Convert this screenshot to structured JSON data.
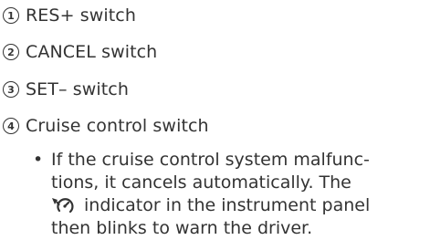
{
  "items": [
    {
      "number": "1",
      "label": "RES+ switch"
    },
    {
      "number": "2",
      "label": "CANCEL switch"
    },
    {
      "number": "3",
      "label": "SET– switch"
    },
    {
      "number": "4",
      "label": "Cruise control switch"
    }
  ],
  "note": {
    "bullet": "•",
    "line1": "If the cruise control system malfunc-",
    "line2": "tions, it cancels automatically. The",
    "line3_after_icon": "indicator in the instrument panel",
    "line4": "then blinks to warn the driver.",
    "icon": "cruise-control-indicator-icon"
  }
}
